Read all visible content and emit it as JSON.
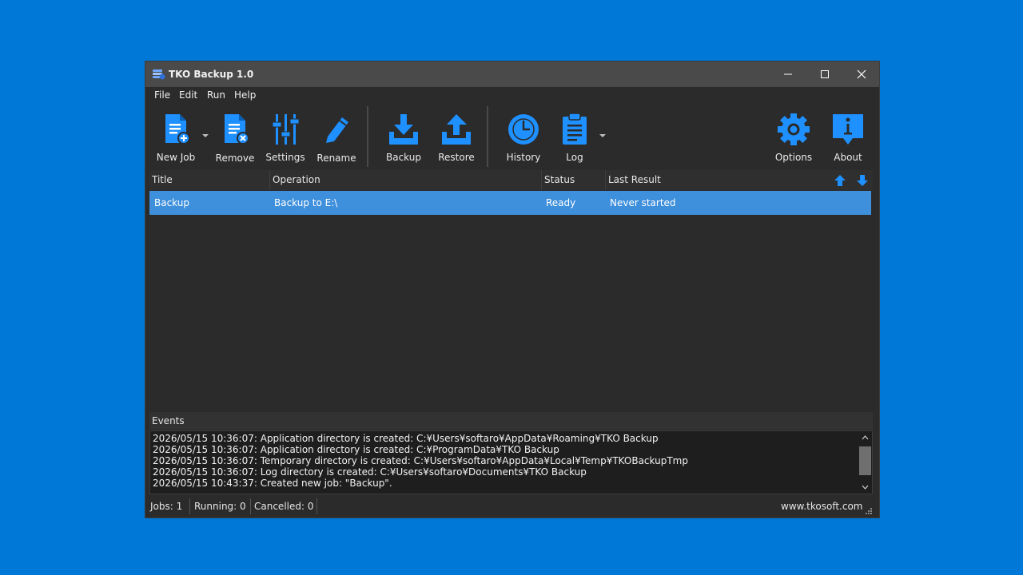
{
  "window": {
    "title": "TKO Backup 1.0"
  },
  "menu": {
    "items": [
      "File",
      "Edit",
      "Run",
      "Help"
    ]
  },
  "toolbar": {
    "new_job": "New Job",
    "remove": "Remove",
    "settings": "Settings",
    "rename": "Rename",
    "backup": "Backup",
    "restore": "Restore",
    "history": "History",
    "log": "Log",
    "options": "Options",
    "about": "About"
  },
  "jobs": {
    "columns": [
      "Title",
      "Operation",
      "Status",
      "Last Result"
    ],
    "rows": [
      {
        "title": "Backup",
        "operation": "Backup to E:\\",
        "status": "Ready",
        "last_result": "Never started"
      }
    ]
  },
  "events": {
    "title": "Events",
    "lines": [
      "2026/05/15 10:36:07: Application directory is created: C:¥Users¥softaro¥AppData¥Roaming¥TKO Backup",
      "2026/05/15 10:36:07: Application directory is created: C:¥ProgramData¥TKO Backup",
      "2026/05/15 10:36:07: Temporary directory is created: C:¥Users¥softaro¥AppData¥Local¥Temp¥TKOBackupTmp",
      "2026/05/15 10:36:07: Log directory is created: C:¥Users¥softaro¥Documents¥TKO Backup",
      "2026/05/15 10:43:37: Created new job: \"Backup\"."
    ]
  },
  "status": {
    "jobs": "Jobs: 1",
    "running": "Running: 0",
    "cancelled": "Cancelled: 0",
    "website": "www.tkosoft.com"
  },
  "colors": {
    "desktop": "#0078d7",
    "accent_icon": "#1e90ff",
    "selected_row": "#3e8fdc"
  }
}
